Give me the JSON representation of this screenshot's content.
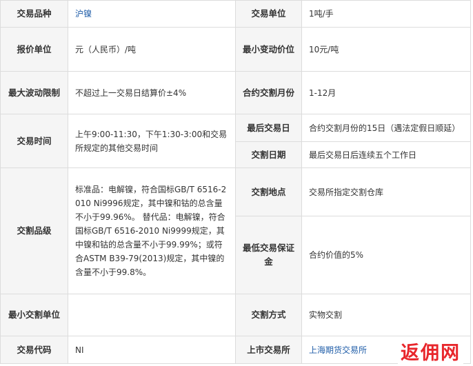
{
  "table": {
    "product_label": "交易品种",
    "product_value": "沪镍",
    "unit_label": "交易单位",
    "unit_value": "1吨/手",
    "quote_label": "报价单位",
    "quote_value": "元（人民币）/吨",
    "tick_label": "最小变动价位",
    "tick_value": "10元/吨",
    "limit_label": "最大波动限制",
    "limit_value": "不超过上一交易日结算价±4%",
    "months_label": "合约交割月份",
    "months_value": "1-12月",
    "hours_label": "交易时间",
    "hours_value": "上午9:00-11:30，下午1:30-3:00和交易所规定的其他交易时间",
    "last_day_label": "最后交易日",
    "last_day_value": "合约交割月份的15日（遇法定假日顺延）",
    "delivery_date_label": "交割日期",
    "delivery_date_value": "最后交易日后连续五个工作日",
    "grade_label": "交割品级",
    "grade_value": "标准品：电解镍，符合国标GB/T 6516-2010 Ni9996规定，其中镍和钴的总含量不小于99.96%。 替代品：电解镍，符合国标GB/T 6516-2010 Ni9999规定，其中镍和钴的总含量不小于99.99%；或符合ASTM B39-79(2013)规定，其中镍的含量不小于99.8%。",
    "location_label": "交割地点",
    "location_value": "交易所指定交割仓库",
    "margin_label": "最低交易保证金",
    "margin_value": "合约价值的5%",
    "min_delivery_label": "最小交割单位",
    "min_delivery_value": "",
    "method_label": "交割方式",
    "method_value": "实物交割",
    "code_label": "交易代码",
    "code_value": "NI",
    "exchange_label": "上市交易所",
    "exchange_value": "上海期货交易所"
  },
  "watermark": "返佣网",
  "colors": {
    "label_bg": "#f5f5f5",
    "border": "#dcdcdc",
    "link": "#1f5da8",
    "watermark": "#e8262b"
  }
}
